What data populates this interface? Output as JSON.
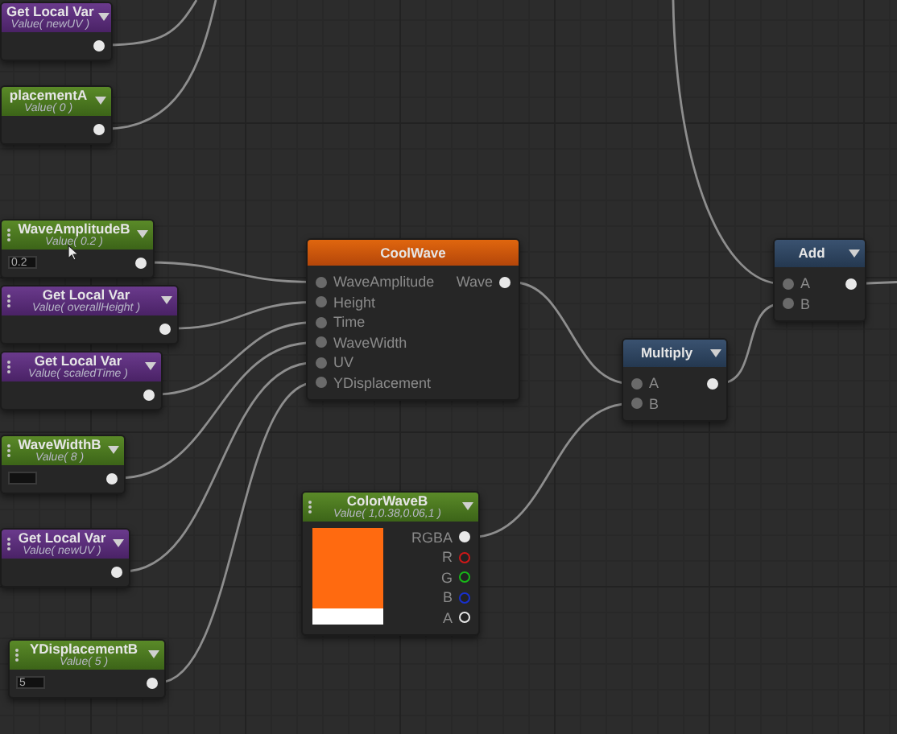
{
  "nodes": [
    {
      "kind": "variable",
      "title": "Get Local Var",
      "subtitle": "Value( newUV )"
    },
    {
      "kind": "constant",
      "title": "placementA",
      "subtitle": "Value( 0 )"
    },
    {
      "kind": "constant",
      "title": "WaveAmplitudeB",
      "subtitle": "Value( 0.2 )",
      "input_field": true,
      "field_value": "0.2"
    },
    {
      "kind": "variable",
      "title": "Get Local Var",
      "subtitle": "Value( overallHeight )"
    },
    {
      "kind": "variable",
      "title": "Get Local Var",
      "subtitle": "Value( scaledTime )"
    },
    {
      "kind": "constant",
      "title": "WaveWidthB",
      "subtitle": "Value( 8 )",
      "input_field": true
    },
    {
      "kind": "variable",
      "title": "Get Local Var",
      "subtitle": "Value( newUV )"
    },
    {
      "kind": "constant",
      "title": "YDisplacementB",
      "subtitle": "Value( 5 )",
      "input_field": true,
      "field_value": "5"
    },
    {
      "kind": "function",
      "title": "CoolWave",
      "inputs": [
        "WaveAmplitude",
        "Height",
        "Time",
        "WaveWidth",
        "UV",
        "YDisplacement"
      ],
      "outputs": [
        {
          "label": "Wave",
          "color": "#e8e8e8",
          "kind": "dot"
        }
      ]
    },
    {
      "kind": "color",
      "title": "ColorWaveB",
      "subtitle": "Value( 1,0.38,0.06,1 )",
      "preview": {
        "color": "#ff6a10"
      },
      "outputs": [
        {
          "label": "RGBA",
          "color": "#e8e8e8",
          "kind": "dot"
        },
        {
          "label": "R",
          "color": "#d01818",
          "kind": "ring"
        },
        {
          "label": "G",
          "color": "#18b818",
          "kind": "ring"
        },
        {
          "label": "B",
          "color": "#1830d0",
          "kind": "ring"
        },
        {
          "label": "A",
          "color": "#e8e8e8",
          "kind": "ring"
        }
      ]
    },
    {
      "kind": "operator",
      "title": "Multiply",
      "inputs": [
        "A",
        "B"
      ]
    },
    {
      "kind": "operator",
      "title": "Add",
      "inputs": [
        "A",
        "B"
      ]
    }
  ]
}
